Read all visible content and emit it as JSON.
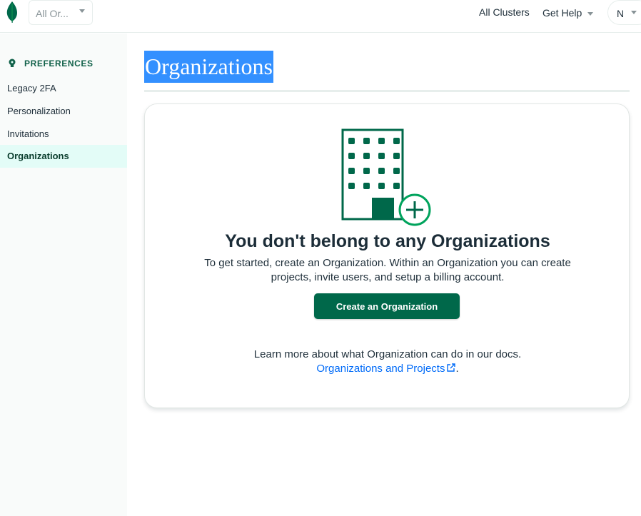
{
  "topbar": {
    "org_select": {
      "value": "All Or..."
    },
    "all_clusters": "All Clusters",
    "get_help": "Get Help",
    "user_initial": "N"
  },
  "sidebar": {
    "header": "PREFERENCES",
    "items": [
      {
        "label": "Legacy 2FA",
        "active": false
      },
      {
        "label": "Personalization",
        "active": false
      },
      {
        "label": "Invitations",
        "active": false
      },
      {
        "label": "Organizations",
        "active": true
      }
    ]
  },
  "main": {
    "title": "Organizations",
    "empty_state": {
      "heading": "You don't belong to any Organizations",
      "description_line1": "To get started, create an Organization. Within an Organization you can create",
      "description_line2": "projects, invite users, and setup a billing account.",
      "button_label": "Create an Organization",
      "learn_more": "Learn more about what Organization can do in our docs.",
      "docs_link": "Organizations and Projects"
    }
  },
  "icons": [
    "mongodb-leaf-icon",
    "chevron-down-icon",
    "lightbulb-icon",
    "building-plus-icon",
    "external-link-icon"
  ],
  "colors": {
    "brand_green": "#00684a",
    "dark_green": "#116149",
    "active_bg": "#e3fcf7",
    "link_blue": "#016bf8",
    "highlight_blue": "#3390ff",
    "plus_green": "#00a35c"
  }
}
